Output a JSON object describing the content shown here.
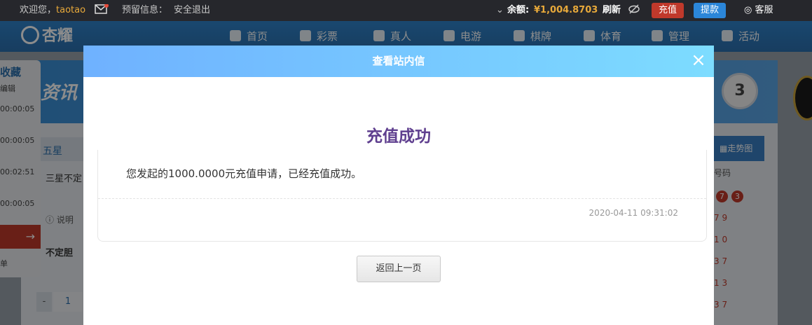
{
  "topbar": {
    "welcome": "欢迎您，",
    "username": "taotao",
    "notice_label": "预留信息：",
    "logout": "安全退出",
    "balance_label": "余额:",
    "balance": "¥1,004.8703",
    "refresh": "刷新",
    "recharge": "充值",
    "withdraw": "提款",
    "service": "客服"
  },
  "nav": {
    "logo": "杏耀",
    "items": [
      "首页",
      "彩票",
      "真人",
      "电游",
      "棋牌",
      "体育",
      "管理",
      "活动"
    ]
  },
  "background": {
    "side": {
      "title": "收藏",
      "sub": "编辑",
      "timers": [
        "00:00:05",
        "00:00:05",
        "00:02:51",
        "00:00:05"
      ],
      "bottom": "单"
    },
    "left": {
      "logo_text": "资讯",
      "tab": "五星",
      "row": "三星不定",
      "info": "说明",
      "type": "不定胆",
      "pager_minus": "-",
      "pager_num": "1"
    },
    "right": {
      "badge": "3",
      "trend": "走势图",
      "col": "号码",
      "balls": [
        "7",
        "3"
      ],
      "nums": [
        "7 9",
        "1 0",
        "3 7",
        "1 3",
        "3 7"
      ]
    }
  },
  "modal": {
    "title": "查看站内信",
    "close": "×",
    "heading": "充值成功",
    "message": "您发起的1000.0000元充值申请，已经充值成功。",
    "time": "2020-04-11 09:31:02",
    "back": "返回上一页"
  },
  "colors": {
    "heading": "#5f3f8f",
    "header_from": "#6fb1ff",
    "header_to": "#7ddcff",
    "recharge": "#c0392b",
    "withdraw": "#2b86d9",
    "balance": "#e8a93a"
  }
}
